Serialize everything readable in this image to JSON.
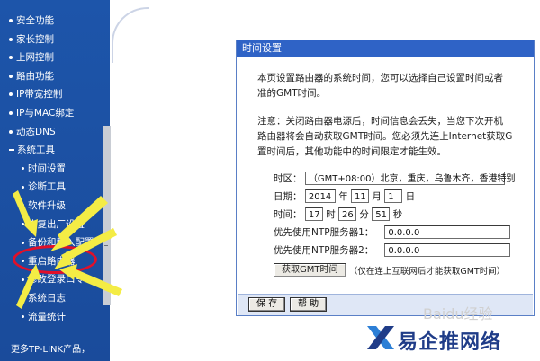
{
  "sidebar": {
    "items": [
      {
        "label": "安全功能",
        "level": "top",
        "marker": "bullet"
      },
      {
        "label": "家长控制",
        "level": "top",
        "marker": "bullet"
      },
      {
        "label": "上网控制",
        "level": "top",
        "marker": "bullet"
      },
      {
        "label": "路由功能",
        "level": "top",
        "marker": "bullet"
      },
      {
        "label": "IP带宽控制",
        "level": "top",
        "marker": "bullet"
      },
      {
        "label": "IP与MAC绑定",
        "level": "top",
        "marker": "bullet"
      },
      {
        "label": "动态DNS",
        "level": "top",
        "marker": "bullet"
      },
      {
        "label": "系统工具",
        "level": "top",
        "marker": "minus"
      },
      {
        "label": "时间设置",
        "level": "sub",
        "marker": "bullet"
      },
      {
        "label": "诊断工具",
        "level": "sub",
        "marker": "bullet"
      },
      {
        "label": "软件升级",
        "level": "sub",
        "marker": "bullet"
      },
      {
        "label": "恢复出厂设置",
        "level": "sub",
        "marker": "bullet"
      },
      {
        "label": "备份和载入配置",
        "level": "sub",
        "marker": "bullet"
      },
      {
        "label": "重启路由器",
        "level": "sub",
        "marker": "bullet"
      },
      {
        "label": "修改登录口令",
        "level": "sub",
        "marker": "bullet"
      },
      {
        "label": "系统日志",
        "level": "sub",
        "marker": "bullet"
      },
      {
        "label": "流量统计",
        "level": "sub",
        "marker": "bullet"
      }
    ],
    "bottom_text": "更多TP-LINK产品，"
  },
  "panel": {
    "title": "时间设置",
    "desc_line1": "本页设置路由器的系统时间，您可以选择自己设置时间或者",
    "desc_line2": "准的GMT时间。",
    "note_line1": "注意：关闭路由器电源后，时间信息会丢失，当您下次开机",
    "note_line2": "路由器将会自动获取GMT时间。您必须先连上Internet获取G",
    "note_line3": "置时间后，其他功能中的时间限定才能生效。",
    "timezone_label": "时区：",
    "timezone_value": "（GMT+08:00）北京，重庆，乌鲁木齐，香港特别",
    "date_label": "日期：",
    "year_value": "2014",
    "year_unit": "年",
    "month_value": "11",
    "month_unit": "月",
    "day_value": "1",
    "day_unit": "日",
    "time_label": "时间：",
    "hour_value": "17",
    "hour_unit": "时",
    "minute_value": "26",
    "minute_unit": "分",
    "second_value": "51",
    "second_unit": "秒",
    "ntp1_label": "优先使用NTP服务器1：",
    "ntp1_value": "0.0.0.0",
    "ntp2_label": "优先使用NTP服务器2：",
    "ntp2_value": "0.0.0.0",
    "get_gmt_button": "获取GMT时间",
    "get_gmt_hint": "（仅在连上互联网后才能获取GMT时间）",
    "save_button": "保 存",
    "help_button": "帮 助"
  },
  "watermark": {
    "logo_text": "易企推网络",
    "baidu_text": "Baidu经验"
  },
  "colors": {
    "sidebar_bg": "#1d55aa",
    "panel_header": "#2f63c6",
    "highlight_circle": "#e0102a",
    "arrow": "#f4ec45"
  }
}
